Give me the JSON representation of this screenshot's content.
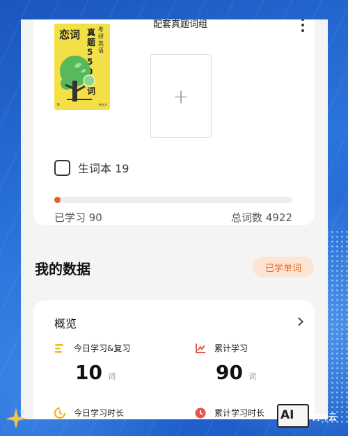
{
  "book": {
    "title_left": "恋词",
    "title_main": "真题5500词",
    "title_side": "考研英语",
    "foot_left": "N",
    "foot_right": "新东方"
  },
  "set_section": {
    "title": "配套真题词组",
    "add_symbol": "+"
  },
  "vocab_book": {
    "label": "生词本 19",
    "checked": false
  },
  "progress": {
    "learned_label": "已学习 90",
    "total_label": "总词数 4922",
    "fraction": 0.018,
    "color": "#e8611f"
  },
  "my_data": {
    "title": "我的数据",
    "learned_words_button": "已学单词"
  },
  "overview": {
    "title": "概览",
    "stats": [
      {
        "label": "今日学习&复习",
        "value": "10",
        "unit": "词",
        "icon": "list-icon",
        "icon_color": "#f0b71a"
      },
      {
        "label": "累计学习",
        "value": "90",
        "unit": "词",
        "icon": "trend-chart-icon",
        "icon_color": "#e0584f"
      },
      {
        "label": "今日学习时长",
        "icon": "clock-partial-icon",
        "icon_color": "#f0b71a"
      },
      {
        "label": "累计学习时长",
        "icon": "clock-icon",
        "icon_color": "#e0584f"
      }
    ]
  },
  "watermark": {
    "badge": "AI",
    "text": "树叶云"
  }
}
